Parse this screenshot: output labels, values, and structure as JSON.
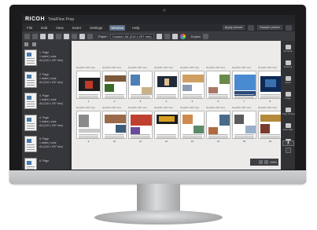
{
  "titlebar": {
    "brand": "RICOH",
    "app_name": "TotalFlow Prep"
  },
  "menubar": {
    "items": [
      "File",
      "Edit",
      "View",
      "Insert",
      "Settings",
      "Window",
      "Help"
    ],
    "active": "Window",
    "preset_select": "Apply preset",
    "printer_select": "Sample printer"
  },
  "toolbar": {
    "paper_label": "Paper:",
    "paper_select": "Custom: A4 (210 x 297 mm)",
    "duplex_label": "Duplex"
  },
  "left_panel": {
    "items": [
      {
        "title": "1. Page",
        "detail": "1 sided | color\nA4 (210 x 297 mm)"
      },
      {
        "title": "2. Page",
        "detail": "1 sided | color\nA4 (210 x 297 mm)"
      },
      {
        "title": "3. Page",
        "detail": "1 sided | color\nA4 (210 x 297 mm)"
      },
      {
        "title": "4. Page",
        "detail": "1 sided | color\nA4 (210 x 297 mm)"
      },
      {
        "title": "5. Page",
        "detail": "1 sided | color\nA4 (210 x 297 mm)"
      },
      {
        "title": "6. Page",
        "detail": ""
      }
    ]
  },
  "pages": {
    "header_text": "A4 (210 x 297 mm)",
    "numbers": [
      "1",
      "2",
      "3",
      "4",
      "5",
      "6",
      "7",
      "8",
      "9",
      "10",
      "11",
      "12",
      "13",
      "14",
      "15",
      "16"
    ]
  },
  "right_panel": {
    "items": [
      "Job Setup",
      "Finishing",
      "Media",
      "Image",
      "Page Content",
      "Insert Tabs",
      "Zoom Out"
    ]
  },
  "zoom": {
    "value": "100%"
  },
  "colors": {
    "accent": "#5a6f8a",
    "canvas": "#ecebea",
    "chrome": "#2f3033"
  }
}
